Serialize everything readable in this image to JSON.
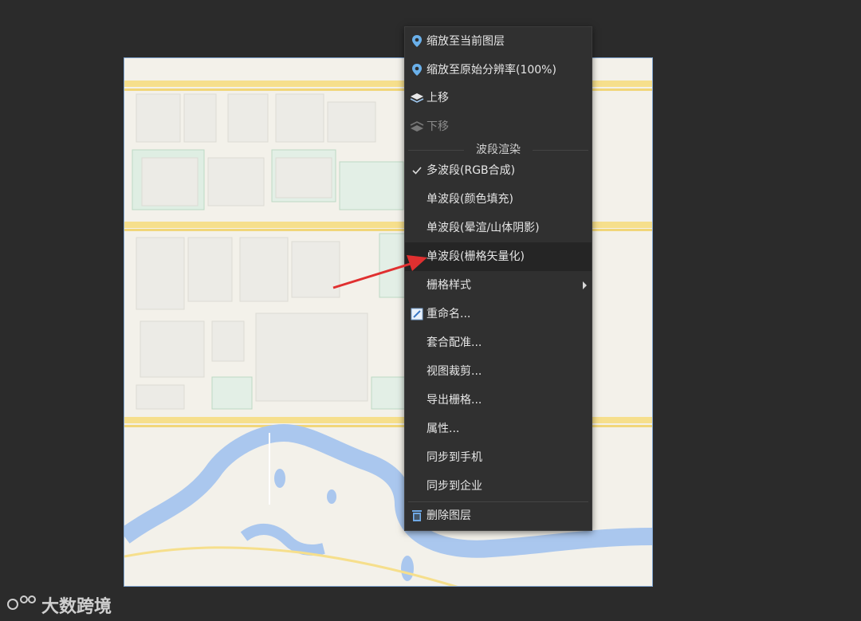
{
  "menu": {
    "items": [
      {
        "label": "缩放至当前图层",
        "icon": "map-pin-icon"
      },
      {
        "label": "缩放至原始分辨率(100%)",
        "icon": "map-pin-icon"
      },
      {
        "label": "上移",
        "icon": "layer-up-icon"
      },
      {
        "label": "下移",
        "icon": "layer-down-icon",
        "disabled": true
      }
    ],
    "section_title": "波段渲染",
    "band_items": [
      {
        "label": "多波段(RGB合成)",
        "checked": true
      },
      {
        "label": "单波段(颜色填充)"
      },
      {
        "label": "单波段(晕渲/山体阴影)"
      },
      {
        "label": "单波段(栅格矢量化)",
        "highlighted": true
      },
      {
        "label": "栅格样式",
        "submenu": true
      }
    ],
    "more_items": [
      {
        "label": "重命名...",
        "icon": "rename-icon"
      },
      {
        "label": "套合配准..."
      },
      {
        "label": "视图裁剪..."
      },
      {
        "label": "导出栅格..."
      },
      {
        "label": "属性..."
      },
      {
        "label": "同步到手机"
      },
      {
        "label": "同步到企业"
      }
    ],
    "delete_label": "删除图层"
  },
  "watermark": {
    "text": "大数跨境"
  },
  "colors": {
    "background": "#2b2b2b",
    "menu_bg": "#303030",
    "highlight": "#252525",
    "arrow": "#e03030",
    "water": "#aac7ee",
    "road": "#f6df8c"
  }
}
